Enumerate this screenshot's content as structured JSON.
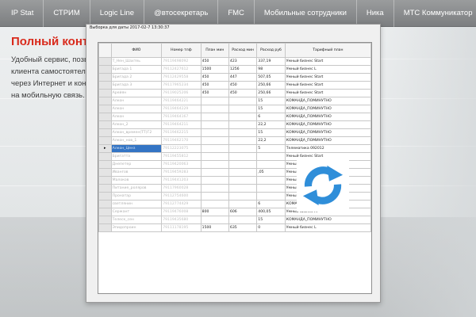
{
  "nav": {
    "items": [
      "IP Stat",
      "СТРИМ",
      "Logic Line",
      "@втосекретарь",
      "FMC",
      "Мобильные сотрудники",
      "Ника",
      "МТС Коммуникатор"
    ]
  },
  "background": {
    "heading": "Полный контр",
    "paragraph": [
      "Удобный сервис, позво",
      "клиента самостоятел",
      "через Интернет и конт",
      "на мобильную связь."
    ]
  },
  "window": {
    "title": "Выборка для даты 2017-02-7 13:30:37",
    "columns": [
      "",
      "ФИО",
      "Номер тлф",
      "План мин",
      "Расход мин",
      "Расход руб",
      "Тарифный план"
    ],
    "rows": [
      {
        "arrow": "",
        "fio": "Т_Нен_Шахтеь",
        "phone": "79119498092",
        "plan": "450",
        "used": "423",
        "cost": "337,19",
        "tariff": "Умный бизнес Start",
        "hl": false
      },
      {
        "arrow": "",
        "fio": "Бригада 1",
        "phone": "79112427612",
        "plan": "1500",
        "used": "1256",
        "cost": "98",
        "tariff": "Умный бизнес L",
        "hl": false
      },
      {
        "arrow": "",
        "fio": "Бригада 2",
        "phone": "79112429558",
        "plan": "450",
        "used": "447",
        "cost": "507,05",
        "tariff": "Умный бизнес Start",
        "hl": false
      },
      {
        "arrow": "",
        "fio": "Бригада 3",
        "phone": "79117965234",
        "plan": "450",
        "used": "450",
        "cost": "250,66",
        "tariff": "Умный бизнес Start",
        "hl": false
      },
      {
        "arrow": "",
        "fio": "Арейян",
        "phone": "79119025206",
        "plan": "450",
        "used": "450",
        "cost": "250,66",
        "tariff": "Умный бизнес Start",
        "hl": false
      },
      {
        "arrow": "",
        "fio": "Алкон",
        "phone": "79119464221",
        "plan": "",
        "used": "",
        "cost": "15",
        "tariff": "КОМАНДА_ПОМИНУТНО",
        "hl": false
      },
      {
        "arrow": "",
        "fio": "Алкон",
        "phone": "79119464229",
        "plan": "",
        "used": "",
        "cost": "15",
        "tariff": "КОМАНДА_ПОМИНУТНО",
        "hl": false
      },
      {
        "arrow": "",
        "fio": "Алкон",
        "phone": "79119464167",
        "plan": "",
        "used": "",
        "cost": "6",
        "tariff": "КОМАНДА_ПОМИНУТНО",
        "hl": false
      },
      {
        "arrow": "",
        "fio": "Алкон_2",
        "phone": "79119464211",
        "plan": "",
        "used": "",
        "cost": "22,2",
        "tariff": "КОМАНДА_ПОМИНУТНО",
        "hl": false
      },
      {
        "arrow": "",
        "fio": "Алкон_времен(ТТ)Г2",
        "phone": "79119462215",
        "plan": "",
        "used": "",
        "cost": "15",
        "tariff": "КОМАНДА_ПОМИНУТНО",
        "hl": false
      },
      {
        "arrow": "",
        "fio": "Алкон_нов_1",
        "phone": "79119462170",
        "plan": "",
        "used": "",
        "cost": "22,2",
        "tariff": "КОМАНДА_ПОМИНУТНО",
        "hl": false
      },
      {
        "arrow": "▸",
        "fio": "Алкон_Ценз",
        "phone": "79112223075",
        "plan": "",
        "used": "",
        "cost": "5",
        "tariff": "Телематика 092012",
        "hl": true
      },
      {
        "arrow": "",
        "fio": "Бригатта",
        "phone": "79119455812",
        "plan": "",
        "used": "",
        "cost": "",
        "tariff": "Умный бизнес Start",
        "hl": false
      },
      {
        "arrow": "",
        "fio": "Днепетер",
        "phone": "79119420063",
        "plan": "",
        "used": "",
        "cost": "",
        "tariff": "Умный бизнес Start",
        "hl": false
      },
      {
        "arrow": "",
        "fio": "Ивангов",
        "phone": "79119459283",
        "plan": "",
        "used": "",
        "cost": ",05",
        "tariff": "Умный бизнес Start",
        "hl": false
      },
      {
        "arrow": "",
        "fio": "Малоков",
        "phone": "79119441203",
        "plan": "",
        "used": "",
        "cost": "",
        "tariff": "Умный бизнес Start",
        "hl": false
      },
      {
        "arrow": "",
        "fio": "Питание_роляров",
        "phone": "79117960028",
        "plan": "",
        "used": "",
        "cost": "",
        "tariff": "Умный бизнес Start",
        "hl": false
      },
      {
        "arrow": "",
        "fio": "Пронатар",
        "phone": "79112754600",
        "plan": "",
        "used": "",
        "cost": "",
        "tariff": "Умный бизнес S 092013",
        "hl": false
      },
      {
        "arrow": "",
        "fio": "светлянин",
        "phone": "79112774429",
        "plan": "",
        "used": "",
        "cost": "6",
        "tariff": "КОМАНДА_ПОМИНУТНО",
        "hl": false
      },
      {
        "arrow": "",
        "fio": "Сержант",
        "phone": "79119476008",
        "plan": "800",
        "used": "606",
        "cost": "400,05",
        "tariff": "Умный бизнес M",
        "hl": false
      },
      {
        "arrow": "",
        "fio": "Телеск_сен",
        "phone": "79119435680",
        "plan": "",
        "used": "",
        "cost": "15",
        "tariff": "КОМАНДА_ПОМИНУТНО",
        "hl": false
      },
      {
        "arrow": "",
        "fio": "Эпидопроин",
        "phone": "79111178195",
        "plan": "1500",
        "used": "635",
        "cost": "0",
        "tariff": "Умный бизнес L",
        "hl": false
      }
    ]
  },
  "overlay": {
    "icon": "refresh-icon",
    "color": "#2f8ed9"
  }
}
